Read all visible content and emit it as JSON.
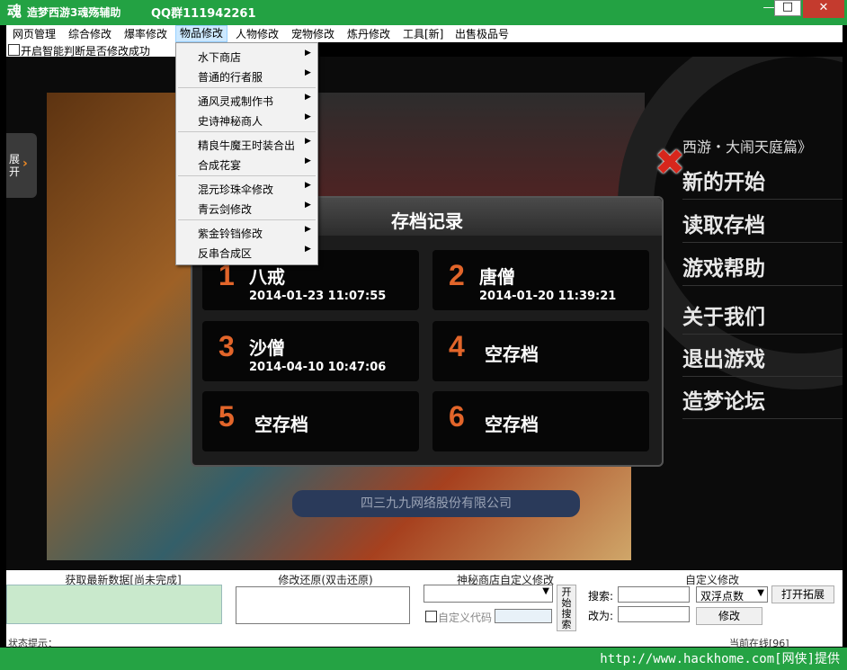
{
  "window": {
    "icon": "魂",
    "title": "造梦西游3魂殇辅助",
    "qq": "QQ群111942261",
    "min": "—",
    "max": "□",
    "close": "✕"
  },
  "menubar": [
    "网页管理",
    "综合修改",
    "爆率修改",
    "物品修改",
    "人物修改",
    "宠物修改",
    "炼丹修改",
    "工具[新]",
    "出售极品号"
  ],
  "checkbox_label": "开启智能判断是否修改成功",
  "dropdown": [
    "水下商店",
    "普通的行者服",
    "通风灵戒制作书",
    "史诗神秘商人",
    "精良牛魔王时装合出",
    "合成花宴",
    "混元珍珠伞修改",
    "青云剑修改",
    "紫金铃铛修改",
    "反串合成区"
  ],
  "dropdown_submenu_arrow": "▶",
  "game": {
    "expand_label": "展开",
    "expand_arrow": "›",
    "close_x": "✖",
    "subtitle": "西游・大闹天庭篇》",
    "menu": [
      "新的开始",
      "读取存档",
      "游戏帮助",
      "关于我们",
      "退出游戏",
      "造梦论坛"
    ],
    "dialog_title": "存档记录",
    "slots": [
      {
        "num": "1",
        "name": "八戒",
        "date": "2014-01-23 11:07:55"
      },
      {
        "num": "2",
        "name": "唐僧",
        "date": "2014-01-20 11:39:21"
      },
      {
        "num": "3",
        "name": "沙僧",
        "date": "2014-04-10 10:47:06"
      },
      {
        "num": "4",
        "name": "空存档",
        "date": ""
      },
      {
        "num": "5",
        "name": "空存档",
        "date": ""
      },
      {
        "num": "6",
        "name": "空存档",
        "date": ""
      }
    ],
    "company": "四三九九网络股份有限公司"
  },
  "bottom": {
    "g1": "获取最新数据[尚未完成]",
    "g2": "修改还原(双击还原)",
    "g3": "神秘商店自定义修改",
    "search_btn": "开始搜索",
    "custom_code": "自定义代码",
    "g4": "自定义修改",
    "search_label": "搜索:",
    "change_label": "改为:",
    "type_select": "双浮点数",
    "expand_btn": "打开拓展",
    "modify_btn": "修改"
  },
  "status": {
    "left": "状态提示：",
    "right": "当前在线[96]"
  },
  "footer": "http://www.hackhome.com[网侠]提供"
}
